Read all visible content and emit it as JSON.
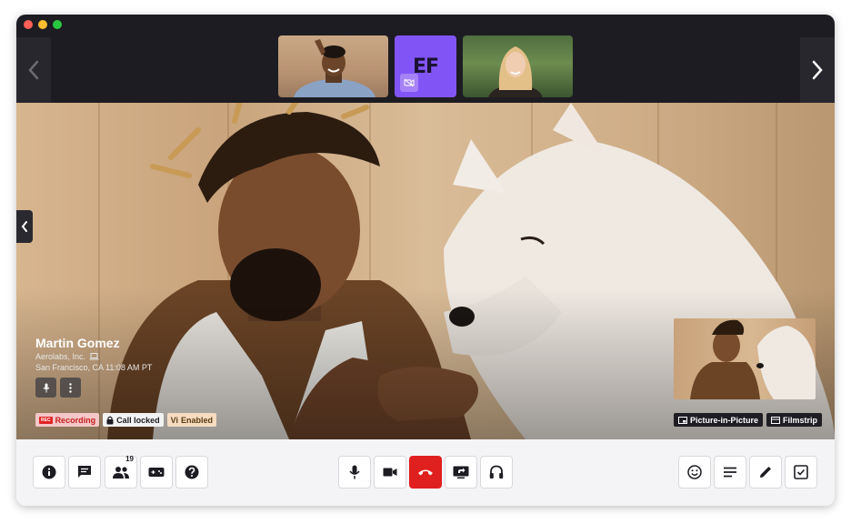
{
  "speaker": {
    "name": "Martin Gomez",
    "org": "Aerolabs, Inc.",
    "location": "San Francisco, CA  11:08 AM PT"
  },
  "thumbnails": [
    {
      "type": "video",
      "icon": "participant-video"
    },
    {
      "type": "initials",
      "initials": "EF",
      "icon": "camera-off-icon",
      "color": "#8155f5"
    },
    {
      "type": "video",
      "icon": "participant-video"
    }
  ],
  "badges": {
    "recording_tag": "REC",
    "recording": "Recording",
    "call_locked": "Call locked",
    "vi_tag": "Vi",
    "vi_enabled": "Enabled"
  },
  "pip": {
    "picture_in_picture": "Picture-in-Picture",
    "filmstrip": "Filmstrip"
  },
  "controls": {
    "left": [
      "info-icon",
      "chat-icon",
      "participants-icon",
      "games-icon",
      "help-icon"
    ],
    "participants_count": "19",
    "center": [
      "microphone-icon",
      "camera-icon",
      "end-call-icon",
      "share-screen-icon",
      "headset-icon"
    ],
    "right": [
      "emoji-icon",
      "notes-icon",
      "pen-icon",
      "checklist-icon"
    ]
  },
  "colors": {
    "topbar": "#1d1c22",
    "end_call": "#e0201e",
    "initials_tile": "#8155f5",
    "recording": "#e02424"
  }
}
